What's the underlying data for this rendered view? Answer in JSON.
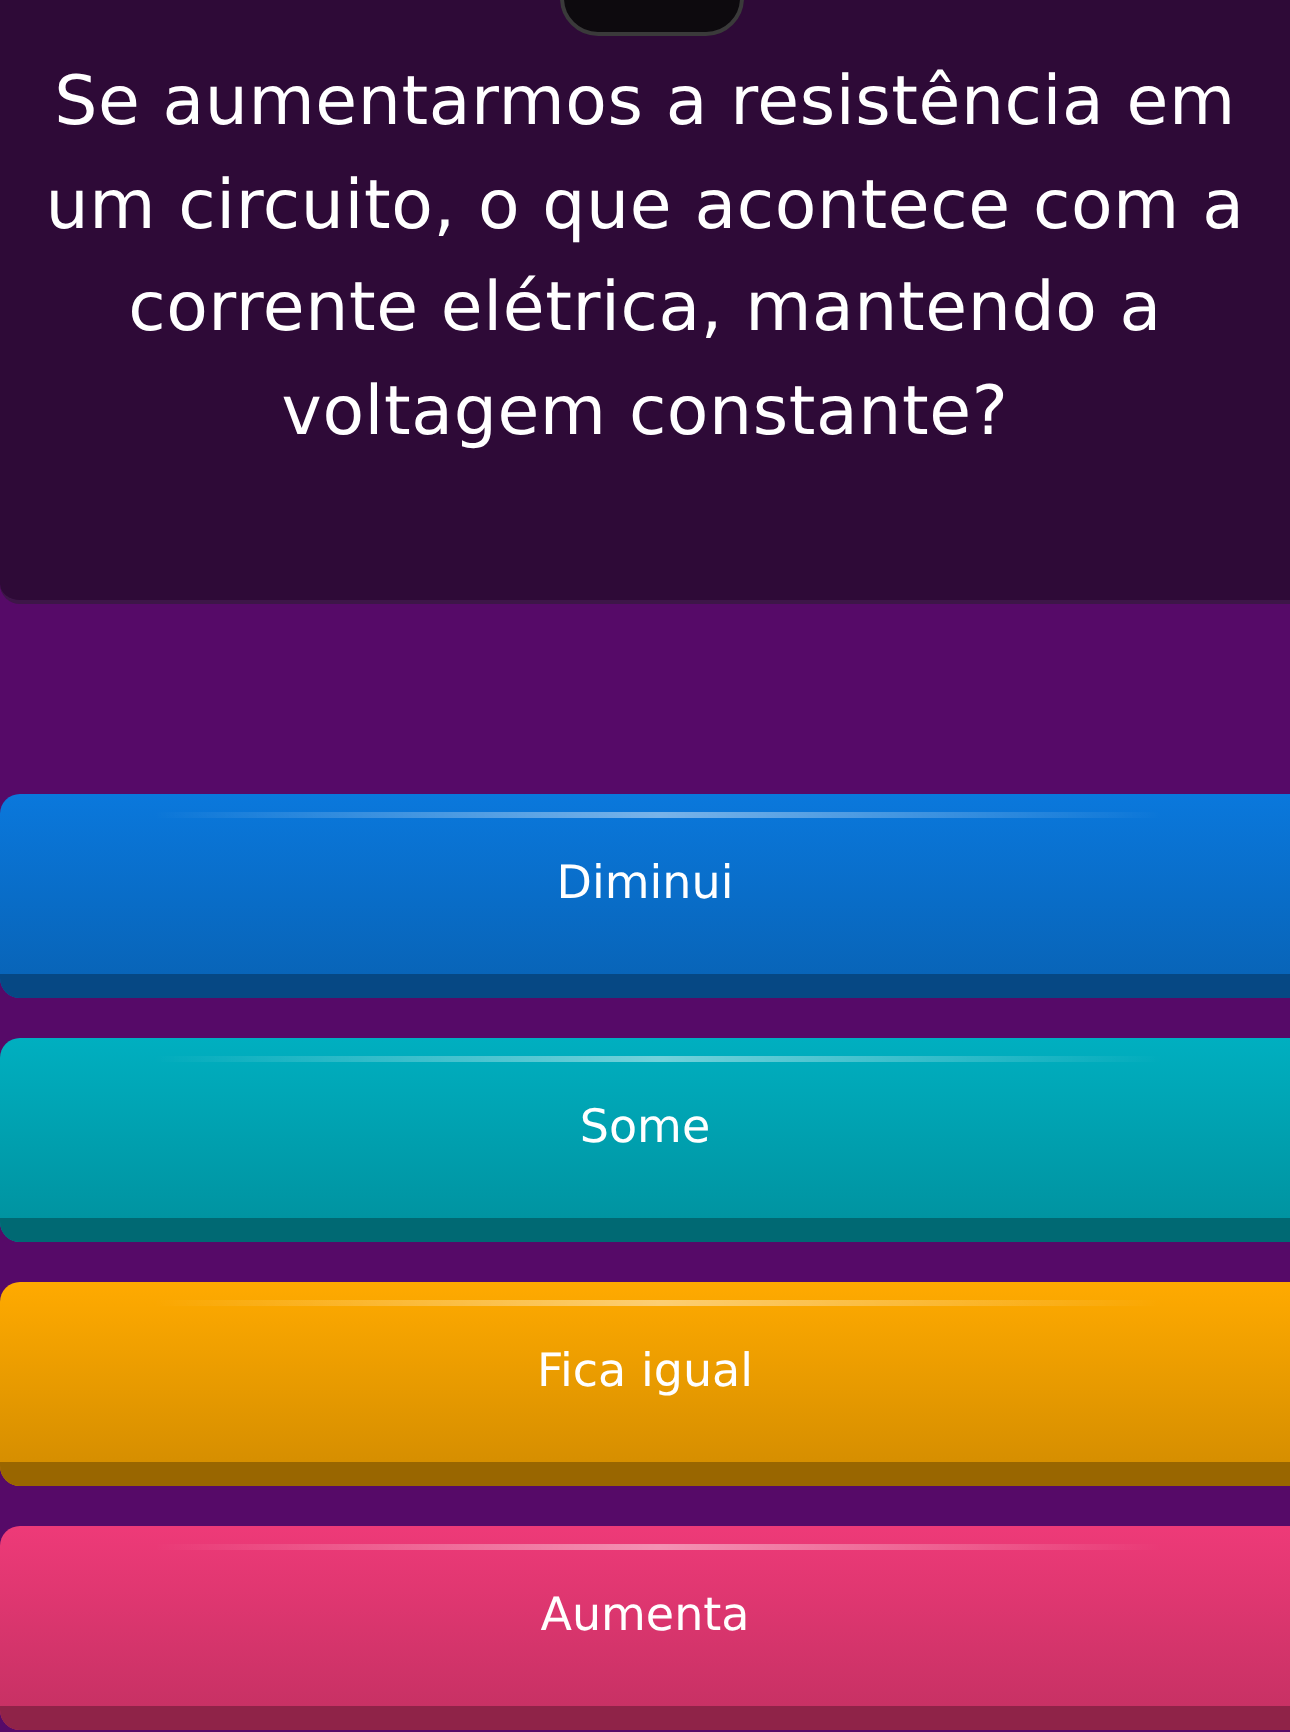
{
  "question": {
    "text": "Se aumentarmos a resistência em um circuito, o que acontece com a corrente elétrica, mantendo a voltagem constante?"
  },
  "options": [
    {
      "label": "Diminui",
      "color": "#0a78dc"
    },
    {
      "label": "Some",
      "color": "#00afc0"
    },
    {
      "label": "Fica igual",
      "color": "#ffaa00"
    },
    {
      "label": "Aumenta",
      "color": "#ee3a78"
    }
  ]
}
